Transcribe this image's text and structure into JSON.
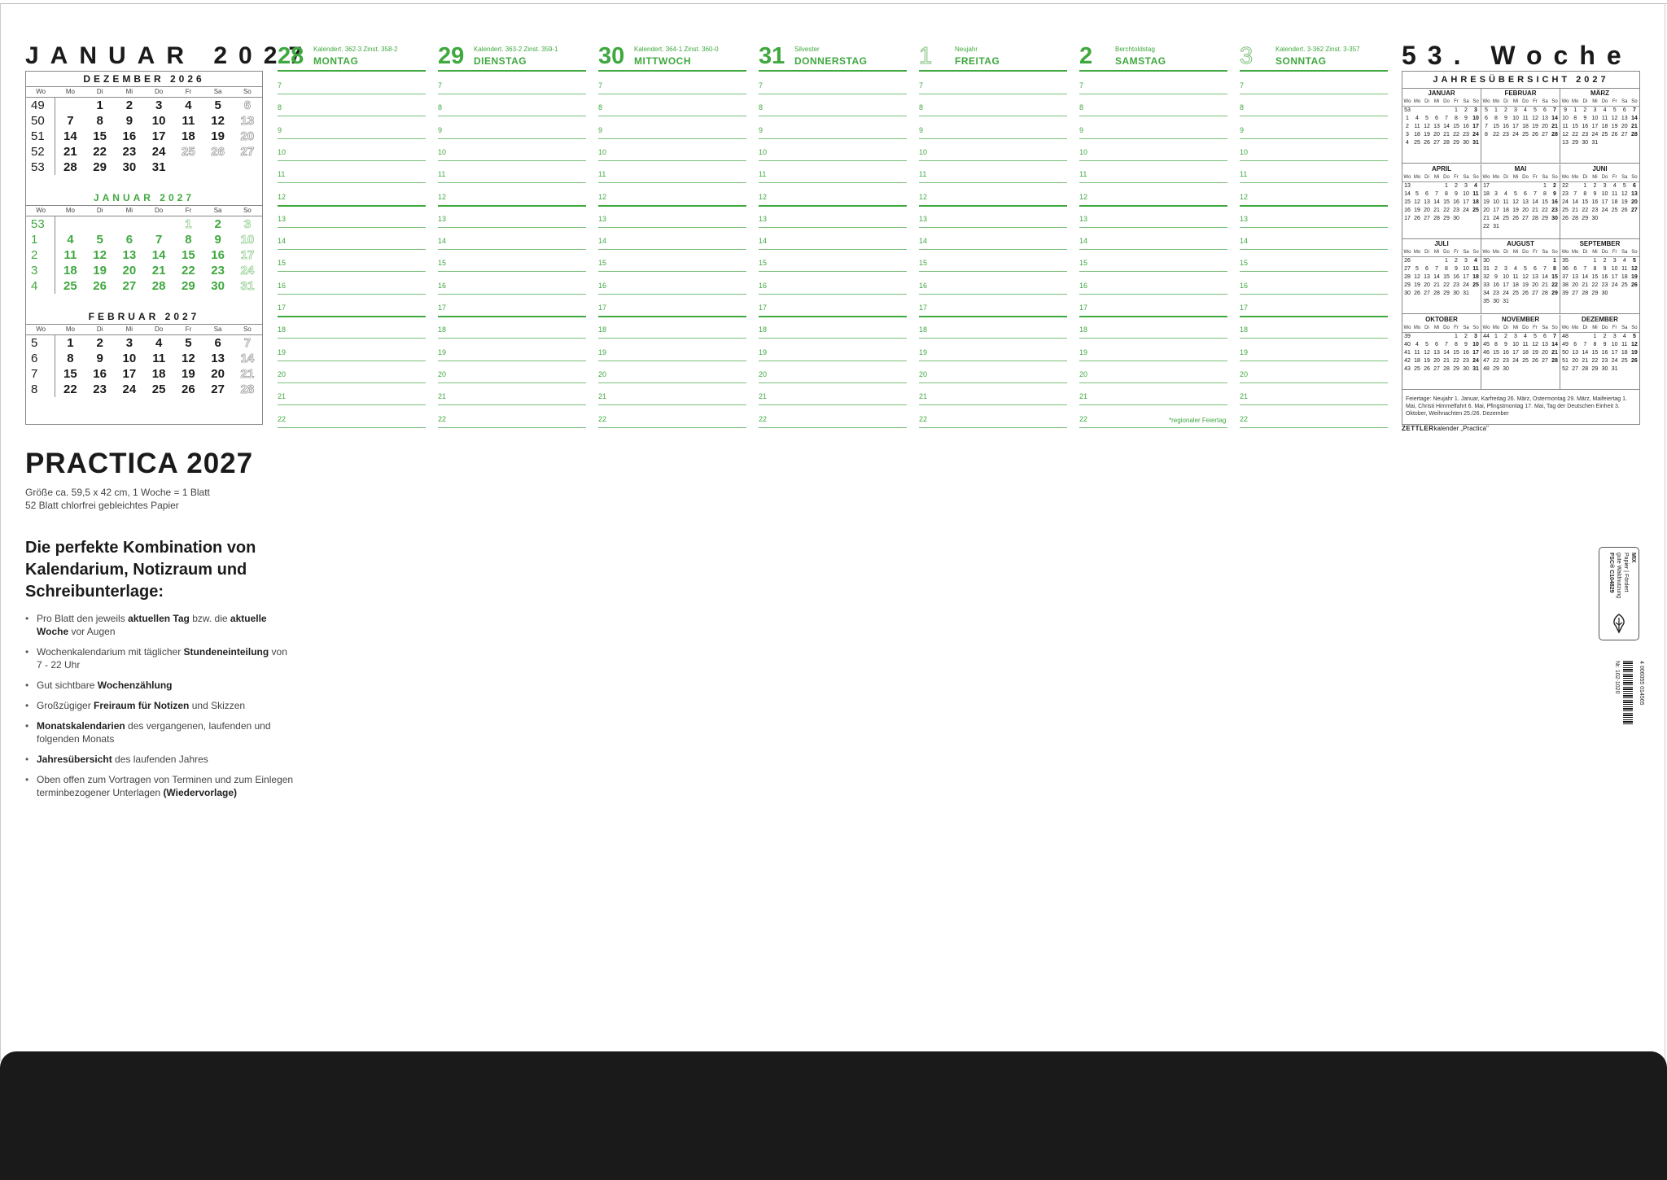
{
  "month_title": "JANUAR 2027",
  "week_title": "53. Woche",
  "weekday_abbr": [
    "Wo",
    "Mo",
    "Di",
    "Mi",
    "Do",
    "Fr",
    "Sa",
    "So"
  ],
  "mini_calendars": [
    {
      "title": "DEZEMBER 2026",
      "rows": [
        {
          "wk": "49",
          "days": [
            "",
            "1",
            "2",
            "3",
            "4",
            "5",
            "6"
          ],
          "out": [
            6
          ]
        },
        {
          "wk": "50",
          "days": [
            "7",
            "8",
            "9",
            "10",
            "11",
            "12",
            "13"
          ],
          "out": [
            6
          ]
        },
        {
          "wk": "51",
          "days": [
            "14",
            "15",
            "16",
            "17",
            "18",
            "19",
            "20"
          ],
          "out": [
            6
          ]
        },
        {
          "wk": "52",
          "days": [
            "21",
            "22",
            "23",
            "24",
            "25",
            "26",
            "27"
          ],
          "out": [
            4,
            5,
            6
          ]
        },
        {
          "wk": "53",
          "days": [
            "28",
            "29",
            "30",
            "31",
            "",
            "",
            ""
          ],
          "out": []
        }
      ]
    },
    {
      "title": "JANUAR 2027",
      "rows": [
        {
          "wk": "53",
          "days": [
            "",
            "",
            "",
            "",
            "1",
            "2",
            "3"
          ],
          "out": [
            4,
            6
          ]
        },
        {
          "wk": "1",
          "days": [
            "4",
            "5",
            "6",
            "7",
            "8",
            "9",
            "10"
          ],
          "out": [
            6
          ]
        },
        {
          "wk": "2",
          "days": [
            "11",
            "12",
            "13",
            "14",
            "15",
            "16",
            "17"
          ],
          "out": [
            6
          ]
        },
        {
          "wk": "3",
          "days": [
            "18",
            "19",
            "20",
            "21",
            "22",
            "23",
            "24"
          ],
          "out": [
            6
          ]
        },
        {
          "wk": "4",
          "days": [
            "25",
            "26",
            "27",
            "28",
            "29",
            "30",
            "31"
          ],
          "out": [
            6
          ]
        }
      ]
    },
    {
      "title": "FEBRUAR 2027",
      "rows": [
        {
          "wk": "5",
          "days": [
            "1",
            "2",
            "3",
            "4",
            "5",
            "6",
            "7"
          ],
          "out": [
            6
          ]
        },
        {
          "wk": "6",
          "days": [
            "8",
            "9",
            "10",
            "11",
            "12",
            "13",
            "14"
          ],
          "out": [
            6
          ]
        },
        {
          "wk": "7",
          "days": [
            "15",
            "16",
            "17",
            "18",
            "19",
            "20",
            "21"
          ],
          "out": [
            6
          ]
        },
        {
          "wk": "8",
          "days": [
            "22",
            "23",
            "24",
            "25",
            "26",
            "27",
            "28"
          ],
          "out": [
            6
          ]
        }
      ]
    }
  ],
  "days": [
    {
      "num": "28",
      "name": "MONTAG",
      "info": "Kalendert. 362-3    Zinst. 358-2",
      "out": false
    },
    {
      "num": "29",
      "name": "DIENSTAG",
      "info": "Kalendert. 363-2    Zinst. 359-1",
      "out": false
    },
    {
      "num": "30",
      "name": "MITTWOCH",
      "info": "Kalendert. 364-1    Zinst. 360-0",
      "out": false
    },
    {
      "num": "31",
      "name": "DONNERSTAG",
      "info": "Silvester",
      "out": false
    },
    {
      "num": "1",
      "name": "FREITAG",
      "info": "Neujahr",
      "out": true
    },
    {
      "num": "2",
      "name": "SAMSTAG",
      "info": "Berchtoldstag",
      "out": false
    },
    {
      "num": "3",
      "name": "SONNTAG",
      "info": "Kalendert. 3-362    Zinst. 3-357",
      "out": true
    }
  ],
  "hours": [
    "7",
    "8",
    "9",
    "10",
    "11",
    "12",
    "13",
    "14",
    "15",
    "16",
    "17",
    "18",
    "19",
    "20",
    "21",
    "22"
  ],
  "regional_note": "*regionaler Feiertag",
  "year_overview": {
    "title": "JAHRESÜBERSICHT 2027",
    "months": [
      {
        "name": "JANUAR",
        "rows": [
          [
            "53",
            "",
            "",
            "",
            "",
            "1",
            "2",
            "3"
          ],
          [
            "1",
            "4",
            "5",
            "6",
            "7",
            "8",
            "9",
            "10"
          ],
          [
            "2",
            "11",
            "12",
            "13",
            "14",
            "15",
            "16",
            "17"
          ],
          [
            "3",
            "18",
            "19",
            "20",
            "21",
            "22",
            "23",
            "24"
          ],
          [
            "4",
            "25",
            "26",
            "27",
            "28",
            "29",
            "30",
            "31"
          ]
        ]
      },
      {
        "name": "FEBRUAR",
        "rows": [
          [
            "5",
            "1",
            "2",
            "3",
            "4",
            "5",
            "6",
            "7"
          ],
          [
            "6",
            "8",
            "9",
            "10",
            "11",
            "12",
            "13",
            "14"
          ],
          [
            "7",
            "15",
            "16",
            "17",
            "18",
            "19",
            "20",
            "21"
          ],
          [
            "8",
            "22",
            "23",
            "24",
            "25",
            "26",
            "27",
            "28"
          ]
        ]
      },
      {
        "name": "MÄRZ",
        "rows": [
          [
            "9",
            "1",
            "2",
            "3",
            "4",
            "5",
            "6",
            "7"
          ],
          [
            "10",
            "8",
            "9",
            "10",
            "11",
            "12",
            "13",
            "14"
          ],
          [
            "11",
            "15",
            "16",
            "17",
            "18",
            "19",
            "20",
            "21"
          ],
          [
            "12",
            "22",
            "23",
            "24",
            "25",
            "26",
            "27",
            "28"
          ],
          [
            "13",
            "29",
            "30",
            "31",
            "",
            "",
            "",
            ""
          ]
        ]
      },
      {
        "name": "APRIL",
        "rows": [
          [
            "13",
            "",
            "",
            "",
            "1",
            "2",
            "3",
            "4"
          ],
          [
            "14",
            "5",
            "6",
            "7",
            "8",
            "9",
            "10",
            "11"
          ],
          [
            "15",
            "12",
            "13",
            "14",
            "15",
            "16",
            "17",
            "18"
          ],
          [
            "16",
            "19",
            "20",
            "21",
            "22",
            "23",
            "24",
            "25"
          ],
          [
            "17",
            "26",
            "27",
            "28",
            "29",
            "30",
            "",
            ""
          ]
        ]
      },
      {
        "name": "MAI",
        "rows": [
          [
            "17",
            "",
            "",
            "",
            "",
            "",
            "1",
            "2"
          ],
          [
            "18",
            "3",
            "4",
            "5",
            "6",
            "7",
            "8",
            "9"
          ],
          [
            "19",
            "10",
            "11",
            "12",
            "13",
            "14",
            "15",
            "16"
          ],
          [
            "20",
            "17",
            "18",
            "19",
            "20",
            "21",
            "22",
            "23"
          ],
          [
            "21",
            "24",
            "25",
            "26",
            "27",
            "28",
            "29",
            "30"
          ],
          [
            "22",
            "31",
            "",
            "",
            "",
            "",
            "",
            ""
          ]
        ]
      },
      {
        "name": "JUNI",
        "rows": [
          [
            "22",
            "",
            "1",
            "2",
            "3",
            "4",
            "5",
            "6"
          ],
          [
            "23",
            "7",
            "8",
            "9",
            "10",
            "11",
            "12",
            "13"
          ],
          [
            "24",
            "14",
            "15",
            "16",
            "17",
            "18",
            "19",
            "20"
          ],
          [
            "25",
            "21",
            "22",
            "23",
            "24",
            "25",
            "26",
            "27"
          ],
          [
            "26",
            "28",
            "29",
            "30",
            "",
            "",
            "",
            ""
          ]
        ]
      },
      {
        "name": "JULI",
        "rows": [
          [
            "26",
            "",
            "",
            "",
            "1",
            "2",
            "3",
            "4"
          ],
          [
            "27",
            "5",
            "6",
            "7",
            "8",
            "9",
            "10",
            "11"
          ],
          [
            "28",
            "12",
            "13",
            "14",
            "15",
            "16",
            "17",
            "18"
          ],
          [
            "29",
            "19",
            "20",
            "21",
            "22",
            "23",
            "24",
            "25"
          ],
          [
            "30",
            "26",
            "27",
            "28",
            "29",
            "30",
            "31",
            ""
          ]
        ]
      },
      {
        "name": "AUGUST",
        "rows": [
          [
            "30",
            "",
            "",
            "",
            "",
            "",
            "",
            "1"
          ],
          [
            "31",
            "2",
            "3",
            "4",
            "5",
            "6",
            "7",
            "8"
          ],
          [
            "32",
            "9",
            "10",
            "11",
            "12",
            "13",
            "14",
            "15"
          ],
          [
            "33",
            "16",
            "17",
            "18",
            "19",
            "20",
            "21",
            "22"
          ],
          [
            "34",
            "23",
            "24",
            "25",
            "26",
            "27",
            "28",
            "29"
          ],
          [
            "35",
            "30",
            "31",
            "",
            "",
            "",
            "",
            ""
          ]
        ]
      },
      {
        "name": "SEPTEMBER",
        "rows": [
          [
            "35",
            "",
            "",
            "1",
            "2",
            "3",
            "4",
            "5"
          ],
          [
            "36",
            "6",
            "7",
            "8",
            "9",
            "10",
            "11",
            "12"
          ],
          [
            "37",
            "13",
            "14",
            "15",
            "16",
            "17",
            "18",
            "19"
          ],
          [
            "38",
            "20",
            "21",
            "22",
            "23",
            "24",
            "25",
            "26"
          ],
          [
            "39",
            "27",
            "28",
            "29",
            "30",
            "",
            "",
            ""
          ]
        ]
      },
      {
        "name": "OKTOBER",
        "rows": [
          [
            "39",
            "",
            "",
            "",
            "",
            "1",
            "2",
            "3"
          ],
          [
            "40",
            "4",
            "5",
            "6",
            "7",
            "8",
            "9",
            "10"
          ],
          [
            "41",
            "11",
            "12",
            "13",
            "14",
            "15",
            "16",
            "17"
          ],
          [
            "42",
            "18",
            "19",
            "20",
            "21",
            "22",
            "23",
            "24"
          ],
          [
            "43",
            "25",
            "26",
            "27",
            "28",
            "29",
            "30",
            "31"
          ]
        ]
      },
      {
        "name": "NOVEMBER",
        "rows": [
          [
            "44",
            "1",
            "2",
            "3",
            "4",
            "5",
            "6",
            "7"
          ],
          [
            "45",
            "8",
            "9",
            "10",
            "11",
            "12",
            "13",
            "14"
          ],
          [
            "46",
            "15",
            "16",
            "17",
            "18",
            "19",
            "20",
            "21"
          ],
          [
            "47",
            "22",
            "23",
            "24",
            "25",
            "26",
            "27",
            "28"
          ],
          [
            "48",
            "29",
            "30",
            "",
            "",
            "",
            "",
            ""
          ]
        ]
      },
      {
        "name": "DEZEMBER",
        "rows": [
          [
            "48",
            "",
            "",
            "1",
            "2",
            "3",
            "4",
            "5"
          ],
          [
            "49",
            "6",
            "7",
            "8",
            "9",
            "10",
            "11",
            "12"
          ],
          [
            "50",
            "13",
            "14",
            "15",
            "16",
            "17",
            "18",
            "19"
          ],
          [
            "51",
            "20",
            "21",
            "22",
            "23",
            "24",
            "25",
            "26"
          ],
          [
            "52",
            "27",
            "28",
            "29",
            "30",
            "31",
            "",
            ""
          ]
        ]
      }
    ],
    "holidays": "Feiertage: Neujahr 1. Januar, Karfreitag 26. März, Ostermontag 29. März, Maifeiertag 1. Mai, Christi Himmelfahrt 6. Mai, Pfingstmontag 17. Mai, Tag der Deutschen Einheit 3. Oktober, Weihnachten 25./26. Dezember"
  },
  "brand": {
    "name": "ZETTLER",
    "suffix": "kalender „Practica\""
  },
  "product": {
    "title": "PRACTICA 2027",
    "spec1": "Größe ca. 59,5 x 42 cm, 1 Woche = 1 Blatt",
    "spec2": "52 Blatt chlorfrei gebleichtes Papier",
    "pitch": "Die perfekte Kombination von Kalendarium, Notizraum und Schreibunterlage:",
    "bullets": [
      {
        "a": "Pro Blatt den jeweils ",
        "b": "aktuellen Tag",
        "c": "",
        "d": " bzw. die ",
        "e": "aktuelle Woche",
        "f": " vor Augen"
      },
      {
        "a": "Wochenkalendarium mit täglicher ",
        "b": "Stundeneinteilung",
        "c": "",
        "d": " von 7 - 22 Uhr",
        "e": "",
        "f": ""
      },
      {
        "a": "Gut sichtbare ",
        "b": "Wochenzählung",
        "c": "",
        "d": "",
        "e": "",
        "f": ""
      },
      {
        "a": "Großzügiger ",
        "b": "Freiraum für Notizen",
        "c": "",
        "d": " und Skizzen",
        "e": "",
        "f": ""
      },
      {
        "a": "",
        "b": "Monatskalendarien",
        "c": "",
        "d": " des vergangenen, laufenden und folgenden Monats",
        "e": "",
        "f": ""
      },
      {
        "a": "",
        "b": "Jahresübersicht",
        "c": "",
        "d": " des laufenden Jahres",
        "e": "",
        "f": ""
      },
      {
        "a": "Oben offen zum Vortragen von Terminen und zum Einlegen terminbezogener Unterlagen ",
        "b": "(Wiedervorlage)",
        "c": "",
        "d": "",
        "e": "",
        "f": ""
      }
    ]
  },
  "fsc": {
    "line1": "MIX",
    "line2": "Papier | Fördert",
    "line3": "gute Waldnutzung",
    "line4": "FSC® C104829"
  },
  "article_no": "Nr. 102-1020",
  "barcode_no": "4 006055 014565",
  "colors": {
    "green": "#3fa83f",
    "black": "#1a1a1a"
  }
}
